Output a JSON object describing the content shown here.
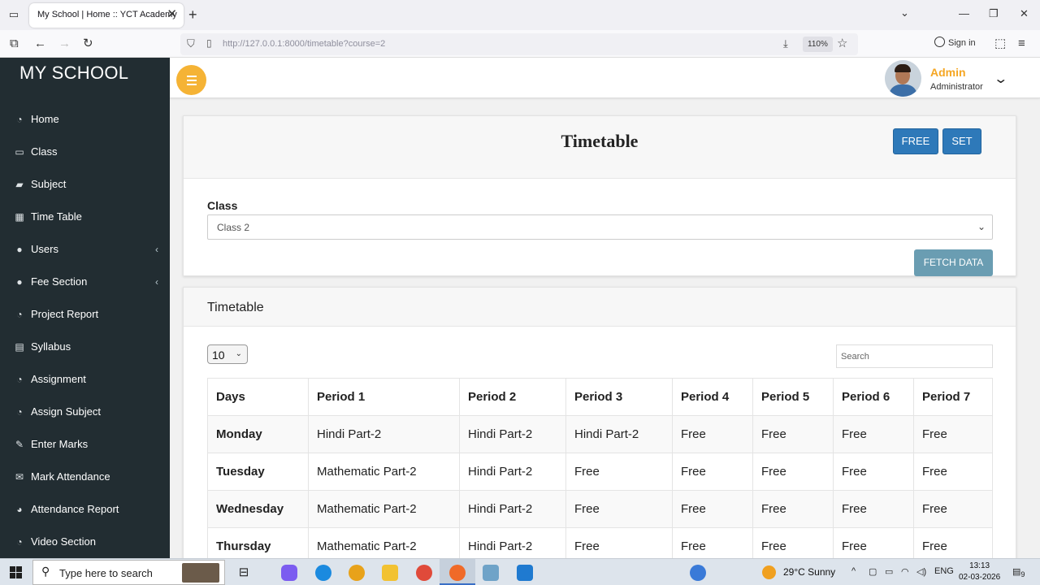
{
  "browser": {
    "tab_title": "My School | Home :: YCT Academy",
    "url_host": "http://127.0.0.1",
    "url_path": ":8000/timetable?course=2",
    "zoom": "110%",
    "sign_in": "Sign in"
  },
  "sidebar": {
    "brand": "MY SCHOOL",
    "items": [
      {
        "label": "Home",
        "icon": "dashboard-icon"
      },
      {
        "label": "Class",
        "icon": "laptop-icon"
      },
      {
        "label": "Subject",
        "icon": "folder-icon"
      },
      {
        "label": "Time Table",
        "icon": "grid-icon"
      },
      {
        "label": "Users",
        "icon": "users-icon",
        "expandable": true
      },
      {
        "label": "Fee Section",
        "icon": "users-icon",
        "expandable": true
      },
      {
        "label": "Project Report",
        "icon": "dashboard-icon"
      },
      {
        "label": "Syllabus",
        "icon": "table-icon"
      },
      {
        "label": "Assignment",
        "icon": "dashboard-icon"
      },
      {
        "label": "Assign Subject",
        "icon": "dashboard-icon"
      },
      {
        "label": "Enter Marks",
        "icon": "edit-icon"
      },
      {
        "label": "Mark Attendance",
        "icon": "envelope-icon"
      },
      {
        "label": "Attendance Report",
        "icon": "pie-chart-icon"
      },
      {
        "label": "Video Section",
        "icon": "dashboard-icon"
      }
    ]
  },
  "header": {
    "user_name": "Admin",
    "user_role": "Administrator"
  },
  "filter_card": {
    "title": "Timetable",
    "free_button": "FREE",
    "set_button": "SET",
    "class_label": "Class",
    "class_value": "Class 2",
    "fetch_button": "FETCH DATA"
  },
  "timetable_card": {
    "title": "Timetable",
    "page_length": "10",
    "search_placeholder": "Search",
    "columns": [
      "Days",
      "Period 1",
      "Period 2",
      "Period 3",
      "Period 4",
      "Period 5",
      "Period 6",
      "Period 7"
    ],
    "rows": [
      [
        "Monday",
        "Hindi Part-2",
        "Hindi Part-2",
        "Hindi Part-2",
        "Free",
        "Free",
        "Free",
        "Free"
      ],
      [
        "Tuesday",
        "Mathematic Part-2",
        "Hindi Part-2",
        "Free",
        "Free",
        "Free",
        "Free",
        "Free"
      ],
      [
        "Wednesday",
        "Mathematic Part-2",
        "Hindi Part-2",
        "Free",
        "Free",
        "Free",
        "Free",
        "Free"
      ],
      [
        "Thursday",
        "Mathematic Part-2",
        "Hindi Part-2",
        "Free",
        "Free",
        "Free",
        "Free",
        "Free"
      ]
    ]
  },
  "taskbar": {
    "search_placeholder": "Type here to search",
    "weather": "29°C  Sunny",
    "language": "ENG",
    "time": "13:13",
    "date": "02-03-2026",
    "notification_count": "9"
  },
  "colors": {
    "sidebar_bg": "#222d32",
    "accent_orange": "#f5b335",
    "button_blue": "#2e79b9",
    "fetch_button": "#6a9db2",
    "admin_name": "#f5a623"
  }
}
